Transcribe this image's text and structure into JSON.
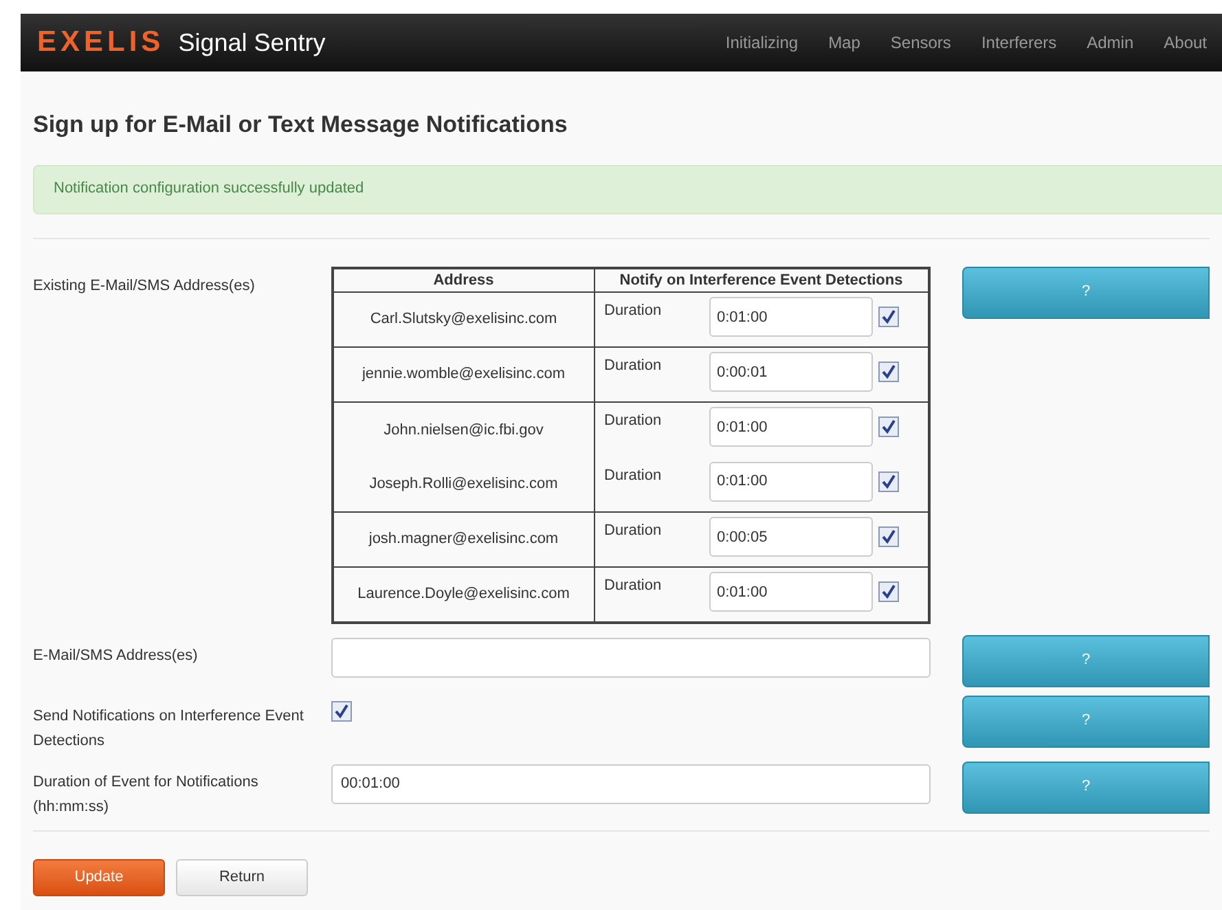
{
  "navbar": {
    "logo": "EXELIS",
    "app_name": "Signal Sentry",
    "links": [
      "Initializing",
      "Map",
      "Sensors",
      "Interferers",
      "Admin",
      "About"
    ]
  },
  "title": "Sign up for E-Mail or Text Message Notifications",
  "alert": "Notification configuration successfully updated",
  "existing": {
    "label": "Existing E-Mail/SMS Address(es)",
    "columns": [
      "Address",
      "Notify on Interference Event Detections"
    ],
    "groups": [
      [
        {
          "address": "Carl.Slutsky@exelisinc.com",
          "duration_label": "Duration",
          "duration": "0:01:00",
          "checked": true
        }
      ],
      [
        {
          "address": "jennie.womble@exelisinc.com",
          "duration_label": "Duration",
          "duration": "0:00:01",
          "checked": true
        }
      ],
      [
        {
          "address": "John.nielsen@ic.fbi.gov",
          "duration_label": "Duration",
          "duration": "0:01:00",
          "checked": true
        },
        {
          "address": "Joseph.Rolli@exelisinc.com",
          "duration_label": "Duration",
          "duration": "0:01:00",
          "checked": true
        }
      ],
      [
        {
          "address": "josh.magner@exelisinc.com",
          "duration_label": "Duration",
          "duration": "0:00:05",
          "checked": true
        }
      ],
      [
        {
          "address": "Laurence.Doyle@exelisinc.com",
          "duration_label": "Duration",
          "duration": "0:01:00",
          "checked": true
        }
      ]
    ],
    "help": "?"
  },
  "fields": [
    {
      "kind": "text",
      "label": "E-Mail/SMS Address(es)",
      "help": "?"
    },
    {
      "kind": "checkbox",
      "label": "Send Notifications on Interference Event Detections",
      "checked": true,
      "help": "?"
    },
    {
      "kind": "text",
      "label": "Duration of Event for Notifications (hh:mm:ss)",
      "value": "00:01:00",
      "help": "?"
    }
  ],
  "buttons": [
    {
      "label": "Update",
      "kind": "primary"
    },
    {
      "label": "Return",
      "kind": "default"
    }
  ]
}
